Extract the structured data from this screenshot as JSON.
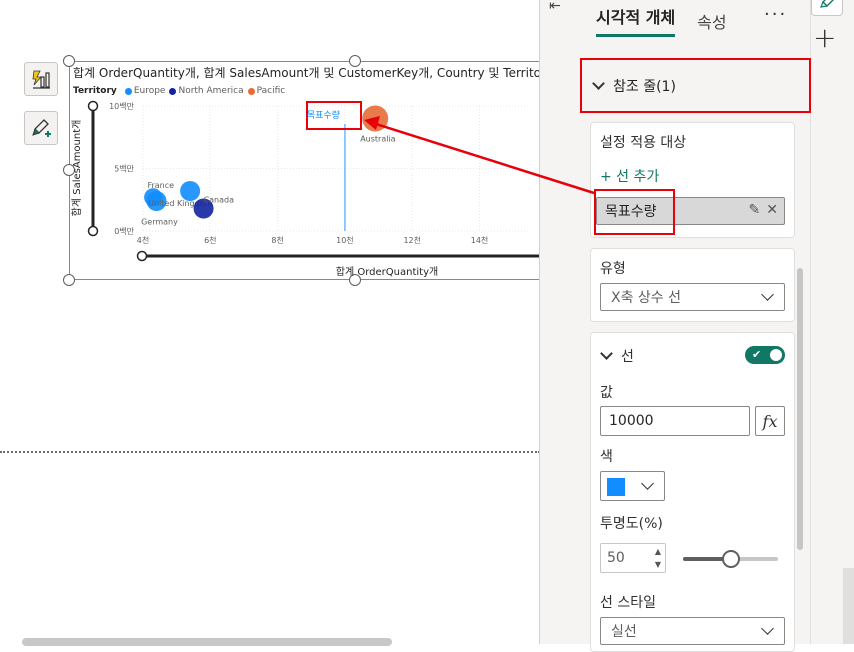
{
  "chart_data": {
    "type": "scatter",
    "title": "합계 OrderQuantity개, 합계 SalesAmount개 및 CustomerKey개, Country 및 Territory",
    "legend": {
      "title": "Territory",
      "placement": "top-left",
      "items": [
        {
          "name": "Europe",
          "color": "#118dff"
        },
        {
          "name": "North America",
          "color": "#12239e"
        },
        {
          "name": "Pacific",
          "color": "#e66c37"
        }
      ]
    },
    "xlabel": "합계 OrderQuantity개",
    "ylabel": "합계 SalesAmount개",
    "x_ticks": [
      "4천",
      "6천",
      "8천",
      "10천",
      "12천",
      "14천"
    ],
    "y_ticks": [
      "0백만",
      "5백만",
      "10백만"
    ],
    "xlim": [
      4000,
      15500
    ],
    "ylim": [
      0,
      10000000
    ],
    "grid": true,
    "points": [
      {
        "label": "France",
        "x": 4400,
        "y": 2400000,
        "series": "Europe"
      },
      {
        "label": "Germany",
        "x": 4300,
        "y": 2700000,
        "series": "Europe"
      },
      {
        "label": "United Kingdom",
        "x": 5400,
        "y": 3200000,
        "series": "Europe"
      },
      {
        "label": "Canada",
        "x": 5800,
        "y": 1800000,
        "series": "North America"
      },
      {
        "label": "Australia",
        "x": 10900,
        "y": 9000000,
        "series": "Pacific"
      }
    ],
    "reference_line": {
      "label": "목표수량",
      "axis": "x",
      "value": 10000,
      "color": "#118dff"
    }
  },
  "pane": {
    "tabs": [
      "시각적 개체",
      "속성"
    ],
    "more": "···",
    "section_title": "참조 줄(1)",
    "apply_to_label": "설정 적용 대상",
    "add_line": "+ 선 추가",
    "selected_line": "목표수량",
    "type_label": "유형",
    "type_value": "X축 상수 선",
    "line_section": "선",
    "line_toggle_on": true,
    "value_label": "값",
    "value": "10000",
    "fx": "fx",
    "color_label": "색",
    "color": "#118dff",
    "transparency_label": "투명도(%)",
    "transparency": "50",
    "transparency_fraction": 0.5,
    "style_label": "선 스타일",
    "style_value": "실선"
  },
  "rail": {
    "add": "+"
  }
}
